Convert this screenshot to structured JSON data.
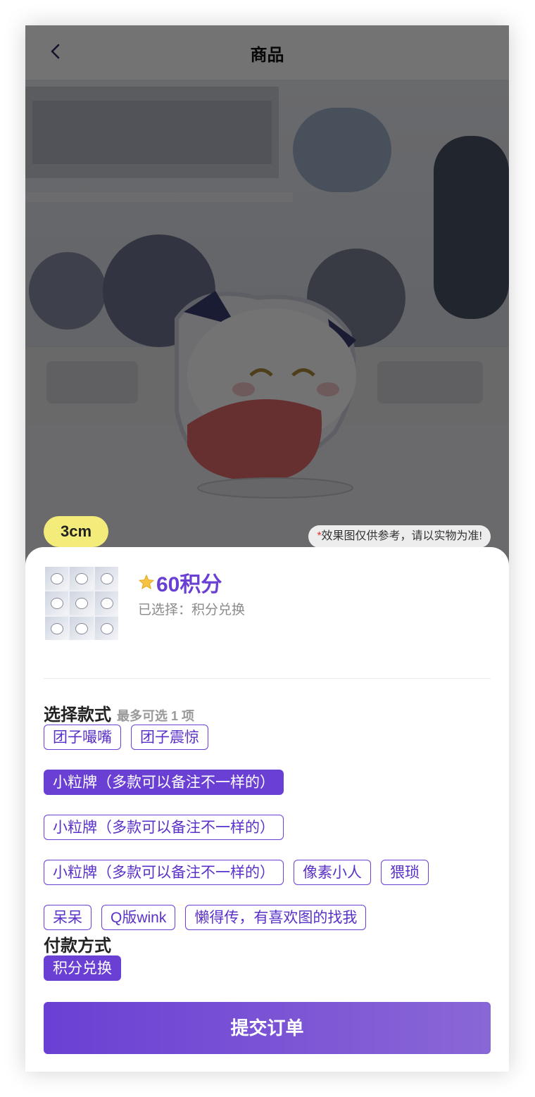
{
  "header": {
    "title": "商品"
  },
  "product_image": {
    "size_badge": "3cm",
    "note_star": "*",
    "note_text": "效果图仅供参考，请以实物为准!"
  },
  "summary": {
    "price": "60积分",
    "selected": "已选择：积分兑换"
  },
  "style_section": {
    "title": "选择款式",
    "hint": "最多可选 1 项",
    "options": [
      {
        "label": "团子嘬嘴",
        "selected": false
      },
      {
        "label": "团子震惊",
        "selected": false
      },
      {
        "label": "小粒牌（多款可以备注不一样的）",
        "selected": true
      },
      {
        "label": "小粒牌（多款可以备注不一样的）",
        "selected": false
      },
      {
        "label": "小粒牌（多款可以备注不一样的）",
        "selected": false
      },
      {
        "label": "像素小人",
        "selected": false
      },
      {
        "label": "猥琐",
        "selected": false
      },
      {
        "label": "呆呆",
        "selected": false
      },
      {
        "label": "Q版wink",
        "selected": false
      },
      {
        "label": "懒得传，有喜欢图的找我",
        "selected": false
      }
    ]
  },
  "payment_section": {
    "title": "付款方式",
    "option": "积分兑换"
  },
  "submit_label": "提交订单",
  "colors": {
    "accent": "#6a3fd4",
    "accent_end": "#8a67d6",
    "note_star": "#e33333",
    "badge": "#f4ec7a"
  }
}
